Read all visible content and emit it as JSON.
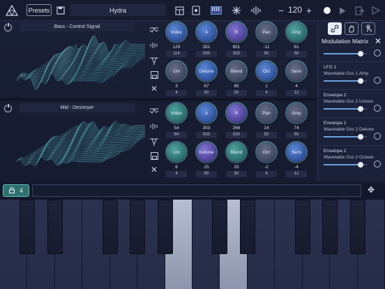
{
  "topbar": {
    "presets_label": "Presets",
    "preset_name": "Hydra",
    "tempo": "120",
    "minus": "−",
    "plus": "+"
  },
  "layers": [
    {
      "name": "Bass - Control Signal",
      "knobs": [
        {
          "label": "Index",
          "value": "129",
          "sub": "114",
          "color": "blue"
        },
        {
          "label": "A",
          "value": "281",
          "sub": "500",
          "color": "blue"
        },
        {
          "label": "R",
          "value": "651",
          "sub": "500",
          "color": "purple"
        },
        {
          "label": "Pan",
          "value": "-11",
          "sub": "50",
          "color": "gray"
        },
        {
          "label": "Amp",
          "value": "61",
          "sub": "50",
          "color": "teal"
        },
        {
          "label": "Uni",
          "value": "3",
          "sub": "4",
          "color": "gray"
        },
        {
          "label": "Detune",
          "value": "67",
          "sub": "50",
          "color": "blue"
        },
        {
          "label": "Blend",
          "value": "65",
          "sub": "50",
          "color": "gray"
        },
        {
          "label": "Oct",
          "value": "1",
          "sub": "4",
          "color": "blue"
        },
        {
          "label": "Semi",
          "value": "4",
          "sub": "12",
          "color": "gray"
        }
      ]
    },
    {
      "name": "Mid - Destroyer",
      "knobs": [
        {
          "label": "Index",
          "value": "54",
          "sub": "84",
          "color": "teal"
        },
        {
          "label": "A",
          "value": "303",
          "sub": "500",
          "color": "blue"
        },
        {
          "label": "R",
          "value": "266",
          "sub": "500",
          "color": "purple"
        },
        {
          "label": "Pan",
          "value": "14",
          "sub": "50",
          "color": "gray"
        },
        {
          "label": "Amp",
          "value": "74",
          "sub": "50",
          "color": "gray"
        },
        {
          "label": "Uni",
          "value": "6",
          "sub": "4",
          "color": "teal"
        },
        {
          "label": "Detune",
          "value": "25",
          "sub": "50",
          "color": "purple"
        },
        {
          "label": "Blend",
          "value": "25",
          "sub": "50",
          "color": "teal"
        },
        {
          "label": "Oct",
          "value": "-2",
          "sub": "4",
          "color": "gray"
        },
        {
          "label": "Semi",
          "value": "-4",
          "sub": "12",
          "color": "blue"
        }
      ]
    }
  ],
  "mod_matrix": {
    "title": "Modulation Matrix",
    "items": [
      {
        "src": "LFO 1",
        "dst": "Wavetable Osc 1 Amp",
        "amount": 0.85
      },
      {
        "src": "Envelope 2",
        "dst": "Wavetable Osc 1 Unison",
        "amount": 0.85
      },
      {
        "src": "Envelope 1",
        "dst": "Wavetable Osc 2 Detune",
        "amount": 0.85
      },
      {
        "src": "Envelope 2",
        "dst": "Wavetable Osc 2 Octave",
        "amount": 0.85
      }
    ]
  },
  "keyboard": {
    "octave": "4"
  }
}
